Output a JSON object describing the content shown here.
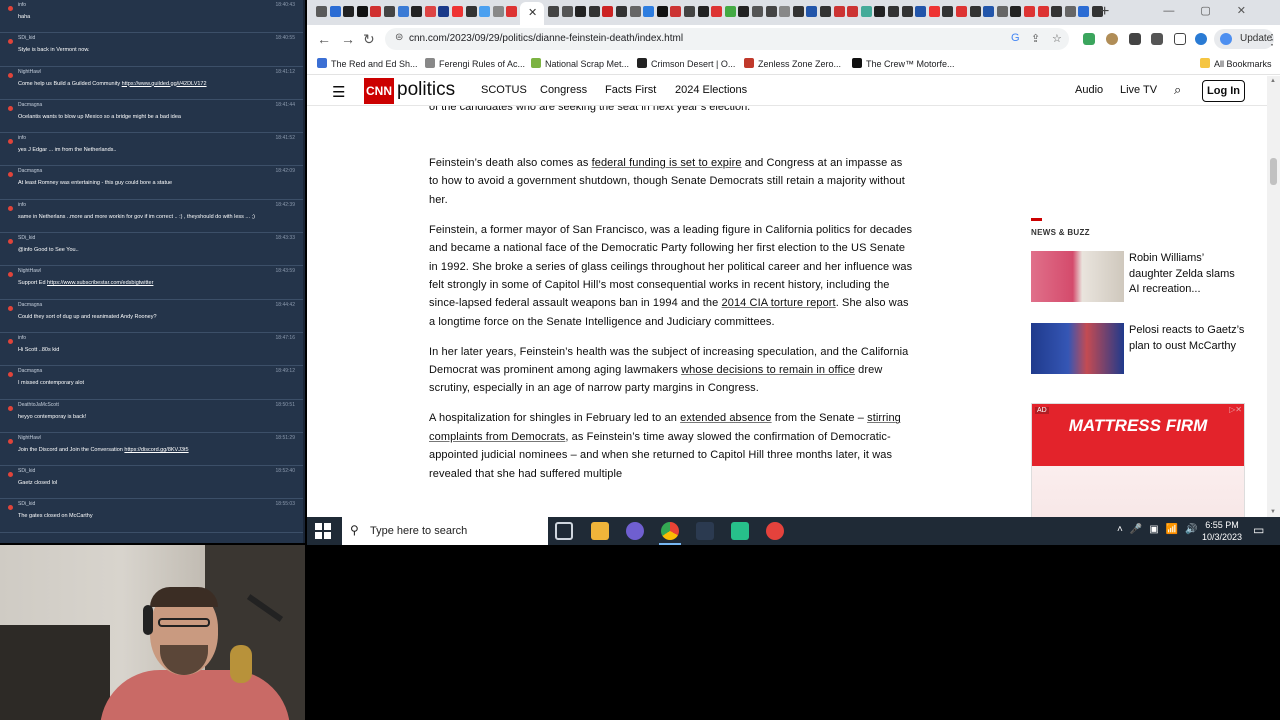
{
  "chat": {
    "messages": [
      {
        "user": "info",
        "time": "18:40:43",
        "text": "haha",
        "link": ""
      },
      {
        "user": "SDi_kid",
        "time": "18:40:55",
        "text": "Style is back in Vermont now.",
        "link": ""
      },
      {
        "user": "NightHawl",
        "time": "18:41:12",
        "text": "Come help us Build a Guilded Community ",
        "link": "https://www.guilded.gg/i/42DLV172"
      },
      {
        "user": "Dacmagna",
        "time": "18:41:44",
        "text": "Ocelantis wants to blow up Mexico so a bridge might be a bad idea",
        "link": ""
      },
      {
        "user": "info",
        "time": "18:41:52",
        "text": "yes J Edgar ... im from the Netherlands..",
        "link": ""
      },
      {
        "user": "Dacmagna",
        "time": "18:42:09",
        "text": "At least Romney was entertaining - this guy could bore a statue",
        "link": ""
      },
      {
        "user": "info",
        "time": "18:42:39",
        "text": "same in Netherlans ..more and more workin for gov if im correct .. :) , theyshould do with less ... ;)",
        "link": ""
      },
      {
        "user": "SDi_kid",
        "time": "18:43:33",
        "text": "@info Good to See You..",
        "link": ""
      },
      {
        "user": "NightHawl",
        "time": "18:43:59",
        "text": "Support Ed ",
        "link": "https://www.subscribestar.com/edsbigtwitter"
      },
      {
        "user": "Dacmagna",
        "time": "18:44:42",
        "text": "Could they sort of dug up and reanimated Andy Rooney?",
        "link": ""
      },
      {
        "user": "info",
        "time": "18:47:16",
        "text": "Hi Scott ..80s kid",
        "link": ""
      },
      {
        "user": "Dacmagna",
        "time": "18:49:12",
        "text": "I missed contemporary alot",
        "link": ""
      },
      {
        "user": "DeathtoJaMcScott",
        "time": "18:50:51",
        "text": "heyyo contemporay is back!",
        "link": ""
      },
      {
        "user": "NightHawl",
        "time": "18:51:29",
        "text": "Join the Discord and Join the Conversation ",
        "link": "https://discord.gg/8KVJ3t5"
      },
      {
        "user": "SDi_kid",
        "time": "18:52:40",
        "text": "Gaetz closed lol",
        "link": ""
      },
      {
        "user": "SDi_kid",
        "time": "18:55:03",
        "text": "The gates closed on McCarthy",
        "link": ""
      }
    ]
  },
  "browser": {
    "address": "cnn.com/2023/09/29/politics/dianne-feinstein-death/index.html",
    "update_label": "Update",
    "new_tab": "+",
    "bookmarks": [
      {
        "label": "The Red and Ed Sh...",
        "color": "#3b6fd4"
      },
      {
        "label": "Ferengi Rules of Ac...",
        "color": "#888888"
      },
      {
        "label": "National Scrap Met...",
        "color": "#7cb342"
      },
      {
        "label": "Crimson Desert | O...",
        "color": "#222222"
      },
      {
        "label": "Zenless Zone Zero...",
        "color": "#c0392b"
      },
      {
        "label": "The Crew™ Motorfe...",
        "color": "#111111"
      }
    ],
    "all_bookmarks": "All Bookmarks"
  },
  "cnn": {
    "logo": "CNN",
    "section": "politics",
    "nav": [
      "SCOTUS",
      "Congress",
      "Facts First",
      "2024 Elections"
    ],
    "right_nav": [
      "Audio",
      "Live TV"
    ],
    "login": "Log In"
  },
  "article": {
    "fragment": "of the candidates who are seeking the seat in next year’s election.",
    "p1a": "Feinstein’s death also comes as ",
    "p1link": "federal funding is set to expire",
    "p1b": " and Congress at an impasse as to how to avoid a government shutdown, though Senate Democrats still retain a majority without her.",
    "p2a": "Feinstein, a former mayor of San Francisco, was a leading figure in California politics for decades and became a national face of the Democratic Party following her first election to the US Senate in 1992. She broke a series of glass ceilings throughout her political career and her influence was felt strongly in some of Capitol Hill’s most consequential works in recent history, including the since-lapsed federal assault weapons ban in 1994 and the ",
    "p2link": "2014 CIA torture report",
    "p2b": ". She also was a longtime force on the Senate Intelligence and Judiciary committees.",
    "p3a": "In her later years, Feinstein’s health was the subject of increasing speculation, and the California Democrat was prominent among aging lawmakers ",
    "p3link": "whose decisions to remain in office",
    "p3b": " drew scrutiny, especially in an age of narrow party margins in Congress.",
    "p4a": "A hospitalization for shingles in February led to an ",
    "p4link": "extended absence",
    "p4b": " from the Senate – ",
    "p4link2": "stirring complaints from Democrats",
    "p4c": ", as Feinstein’s time away slowed the confirmation of Democratic-appointed judicial nominees – and when she returned to Capitol Hill three months later, it was revealed that she had suffered multiple"
  },
  "rail": {
    "heading": "NEWS & BUZZ",
    "cards": [
      {
        "title": "Robin Williams’ daughter Zelda slams AI recreation..."
      },
      {
        "title": "Pelosi reacts to Gaetz’s plan to oust McCarthy"
      }
    ],
    "ad_label": "AD",
    "ad_brand": "MATTRESS FIRM"
  },
  "taskbar": {
    "search_placeholder": "Type here to search",
    "time": "6:55 PM",
    "date": "10/3/2023"
  },
  "colors": {
    "cnn_red": "#cc0000",
    "chat_bg": "#24344a",
    "taskbar_bg": "#1f2a36"
  }
}
